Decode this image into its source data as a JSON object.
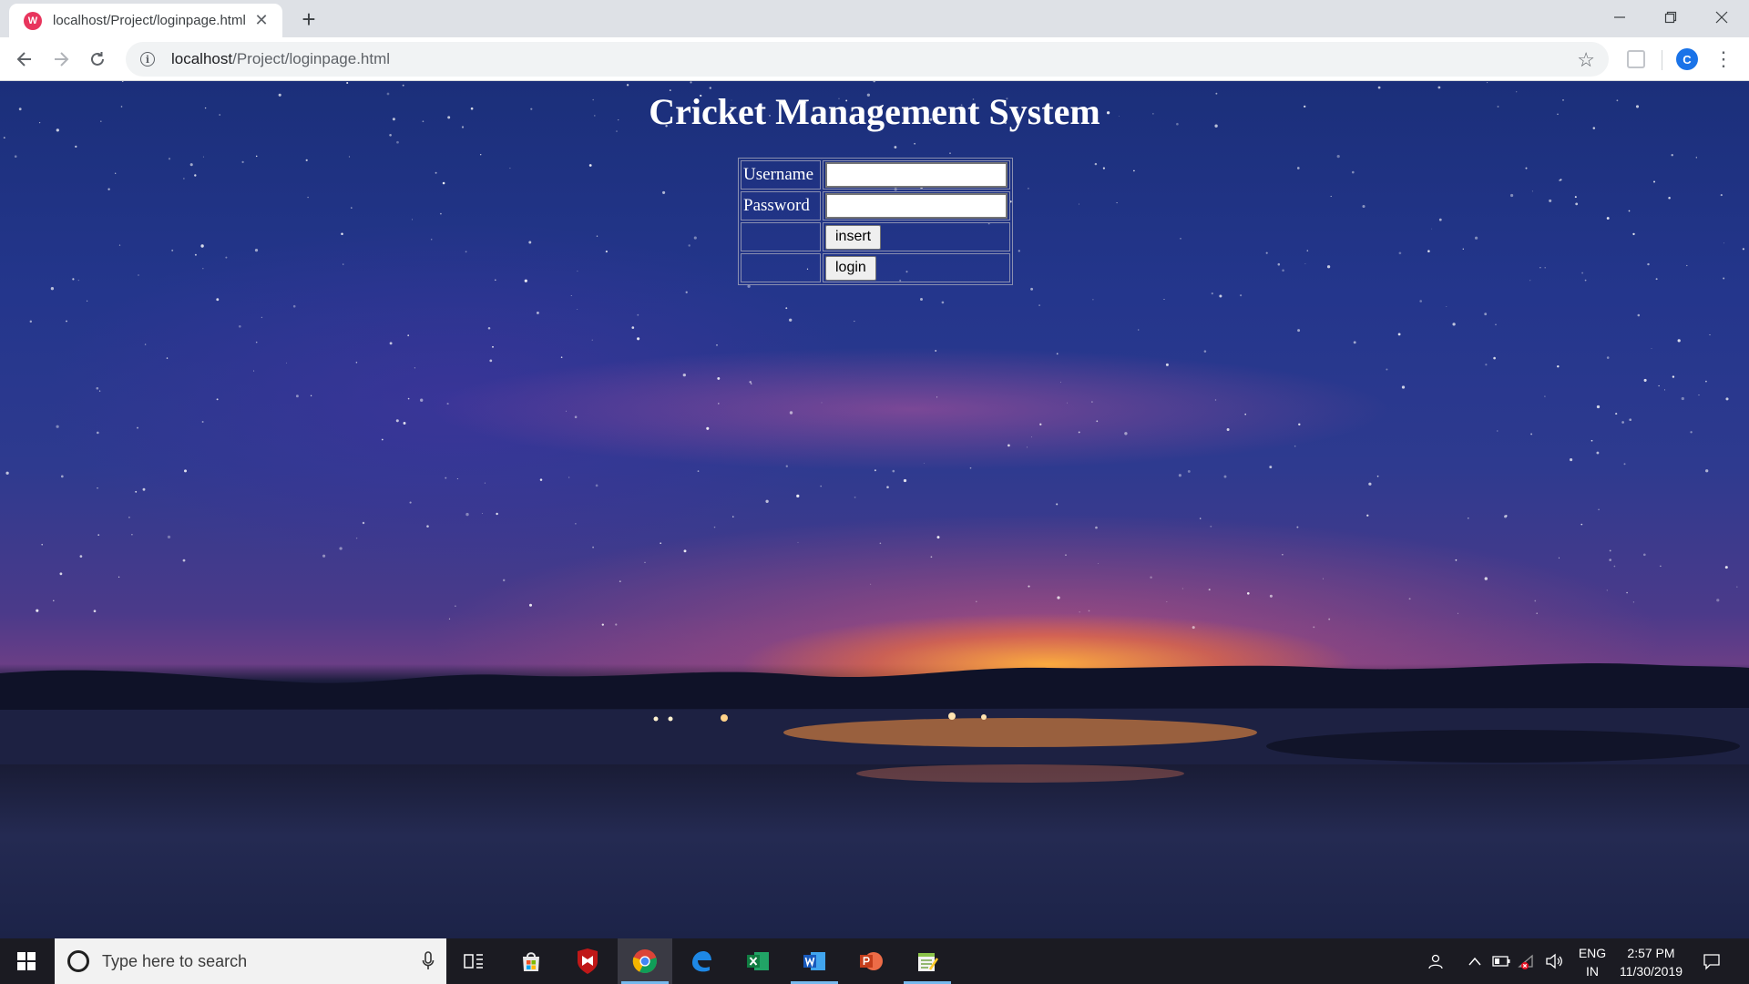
{
  "browser": {
    "tab_title": "localhost/Project/loginpage.html",
    "tab_favicon": "W",
    "url_host": "localhost",
    "url_path": "/Project/loginpage.html",
    "profile_initial": "C"
  },
  "page": {
    "title": "Cricket Management System",
    "username_label": "Username",
    "password_label": "Password",
    "username_value": "",
    "password_value": "",
    "insert_label": "insert",
    "login_label": "login"
  },
  "taskbar": {
    "search_placeholder": "Type here to search",
    "apps": [
      "task-view",
      "microsoft-store",
      "mcafee",
      "chrome",
      "edge",
      "excel",
      "word",
      "powerpoint",
      "notepad-plus-plus"
    ],
    "lang_line1": "ENG",
    "lang_line2": "IN",
    "time": "2:57 PM",
    "date": "11/30/2019"
  },
  "colors": {
    "accent": "#1a73e8",
    "favicon": "#e8355d",
    "taskbar": "#1b1b22",
    "taskbar_active_indicator": "#76b9ed"
  }
}
